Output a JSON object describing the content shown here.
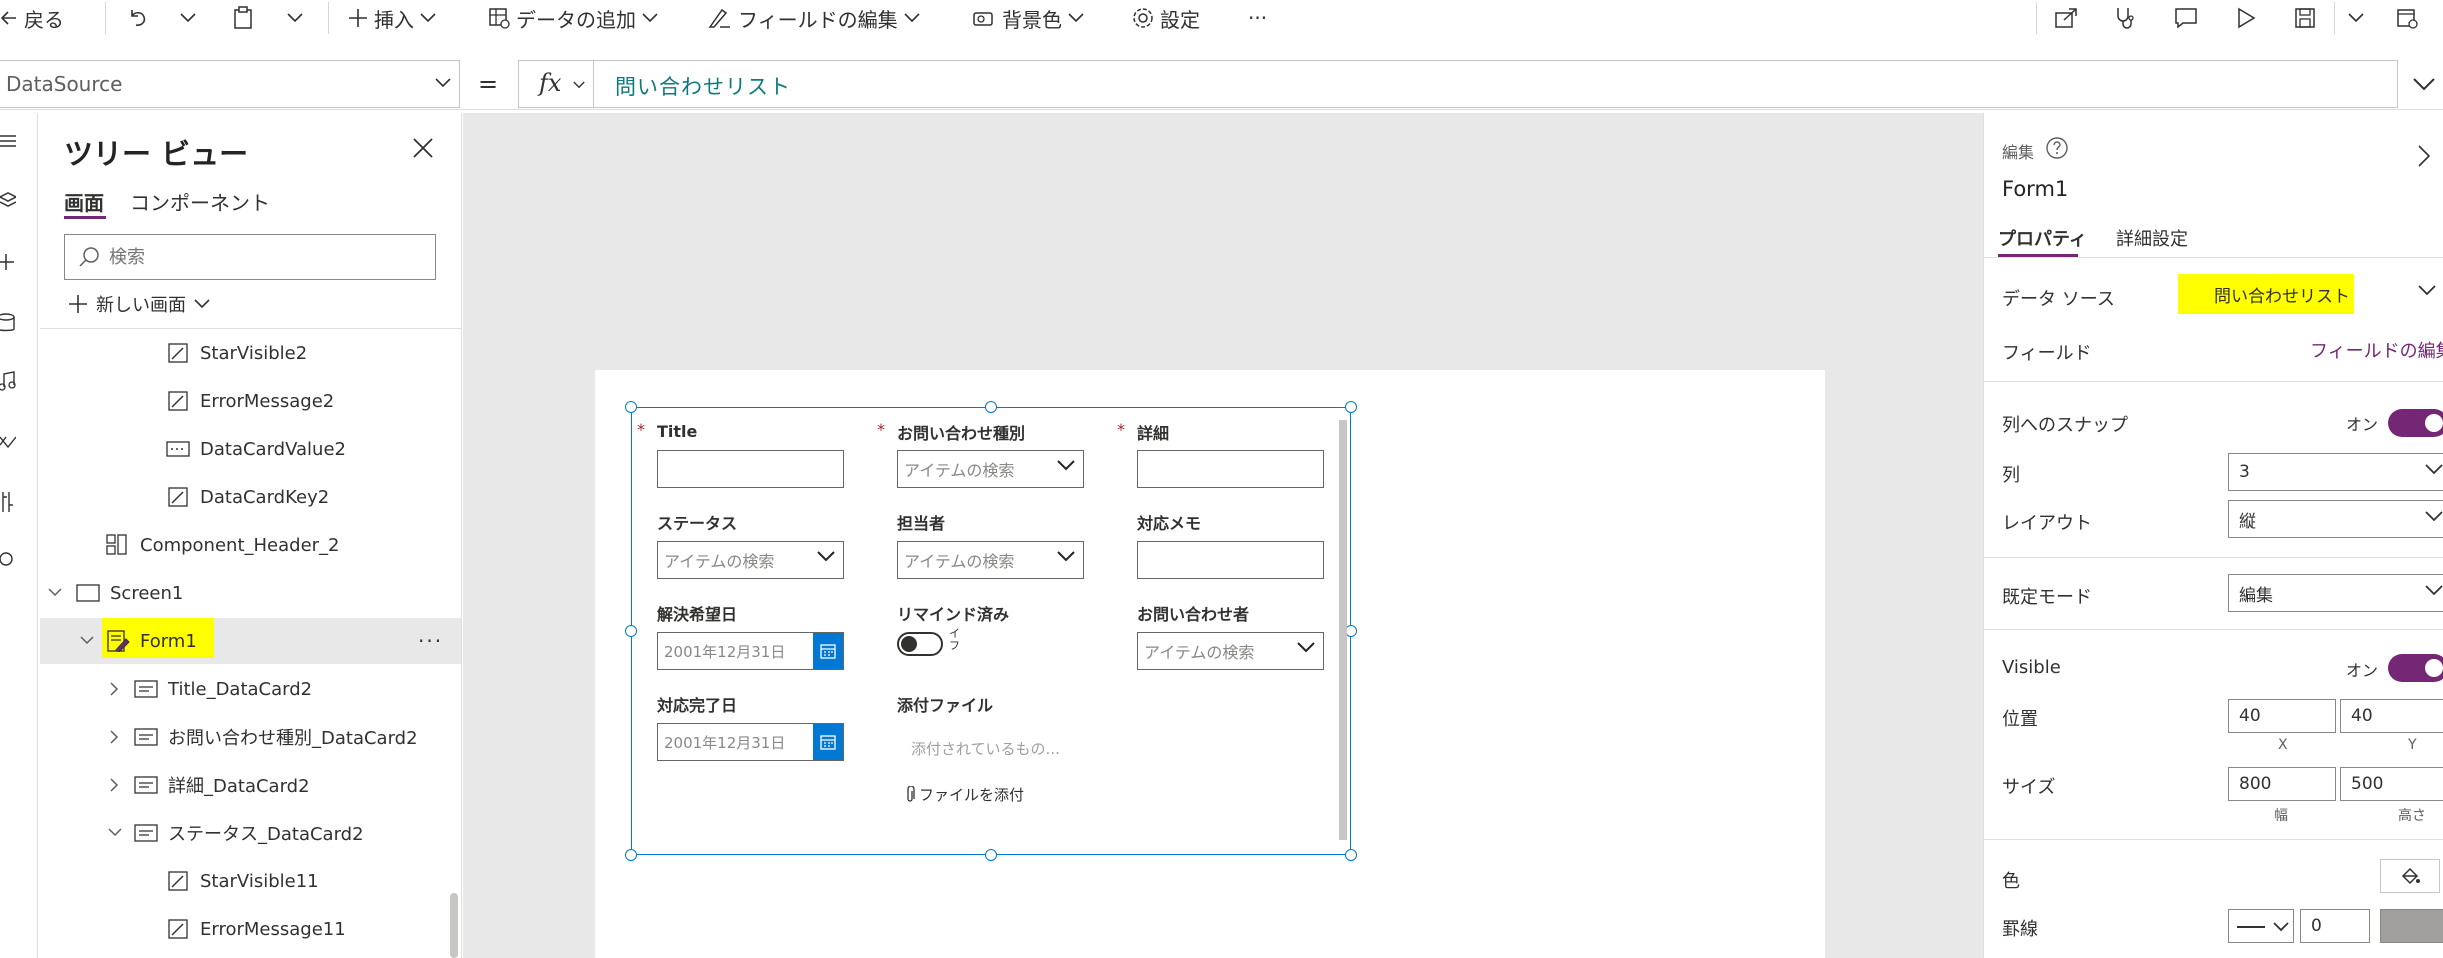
{
  "toolbar": {
    "back": "戻る",
    "insert": "挿入",
    "add_data": "データの追加",
    "edit_fields": "フィールドの編集",
    "background": "背景色",
    "settings": "設定",
    "more": "···"
  },
  "formula_bar": {
    "property": "DataSource",
    "equals": "=",
    "fx": "fx",
    "formula": "問い合わせリスト"
  },
  "tree_view": {
    "title": "ツリー ビュー",
    "tabs": [
      "画面",
      "コンポーネント"
    ],
    "search_placeholder": "検索",
    "new_screen": "新しい画面",
    "items": [
      {
        "label": "StarVisible2"
      },
      {
        "label": "ErrorMessage2"
      },
      {
        "label": "DataCardValue2"
      },
      {
        "label": "DataCardKey2"
      },
      {
        "label": "Component_Header_2"
      },
      {
        "label": "Screen1"
      },
      {
        "label": "Form1"
      },
      {
        "label": "Title_DataCard2"
      },
      {
        "label": "お問い合わせ種別_DataCard2"
      },
      {
        "label": "詳細_DataCard2"
      },
      {
        "label": "ステータス_DataCard2"
      },
      {
        "label": "StarVisible11"
      },
      {
        "label": "ErrorMessage11"
      }
    ],
    "selected_more": "···"
  },
  "form": {
    "fields": {
      "title": "Title",
      "inquiry_type": "お問い合わせ種別",
      "details": "詳細",
      "status": "ステータス",
      "assignee": "担当者",
      "memo": "対応メモ",
      "due_date": "解決希望日",
      "reminded": "リマインド済み",
      "inquirer": "お問い合わせ者",
      "done_date": "対応完了日",
      "attachments": "添付ファイル"
    },
    "star": "*",
    "combo_placeholder": "アイテムの検索",
    "date_value": "2001年12月31日",
    "toggle_label": "イ\nフ",
    "attach_placeholder": "添付されているもの...",
    "attach_link": "ファイルを添付"
  },
  "properties": {
    "section": "編集",
    "control_name": "Form1",
    "tabs": [
      "プロパティ",
      "詳細設定"
    ],
    "data_source_label": "データ ソース",
    "data_source_value": "問い合わせリスト",
    "fields_label": "フィールド",
    "fields_link": "フィールドの編集",
    "snap_label": "列へのスナップ",
    "snap_state": "オン",
    "columns_label": "列",
    "columns_value": "3",
    "layout_label": "レイアウト",
    "layout_value": "縦",
    "default_mode_label": "既定モード",
    "default_mode_value": "編集",
    "visible_label": "Visible",
    "visible_state": "オン",
    "position_label": "位置",
    "x_value": "40",
    "y_value": "40",
    "x_caption": "X",
    "y_caption": "Y",
    "size_label": "サイズ",
    "width_value": "800",
    "height_value": "500",
    "width_caption": "幅",
    "height_caption": "高さ",
    "color_label": "色",
    "border_label": "罫線",
    "border_value": "0"
  },
  "colors": {
    "accent": "#742774",
    "highlight": "#ffff00",
    "formula_text": "#0e7a7a",
    "calendar_blue": "#0078d4"
  }
}
